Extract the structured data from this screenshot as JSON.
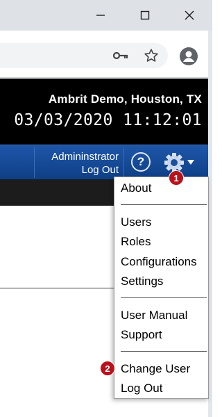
{
  "browser": {
    "window_controls": [
      "minimize-icon",
      "maximize-icon",
      "close-icon"
    ],
    "toolbar_icons": [
      "key-icon",
      "star-icon",
      "profile-icon"
    ]
  },
  "header": {
    "site_name": "Ambrit Demo, Houston, TX",
    "datetime": "03/03/2020 11:12:01"
  },
  "nav": {
    "user_name": "Admininstrator",
    "logout_label": "Log Out",
    "help_label": "?",
    "settings_icon": "gear-icon"
  },
  "menu": {
    "items": [
      "About",
      "Users",
      "Roles",
      "Configurations",
      "Settings",
      "User Manual",
      "Support",
      "Change User",
      "Log Out"
    ]
  },
  "callouts": [
    "1",
    "2"
  ],
  "colors": {
    "header_bg": "#000000",
    "nav_blue": "#1a4f9e",
    "badge_red": "#b8121c"
  }
}
